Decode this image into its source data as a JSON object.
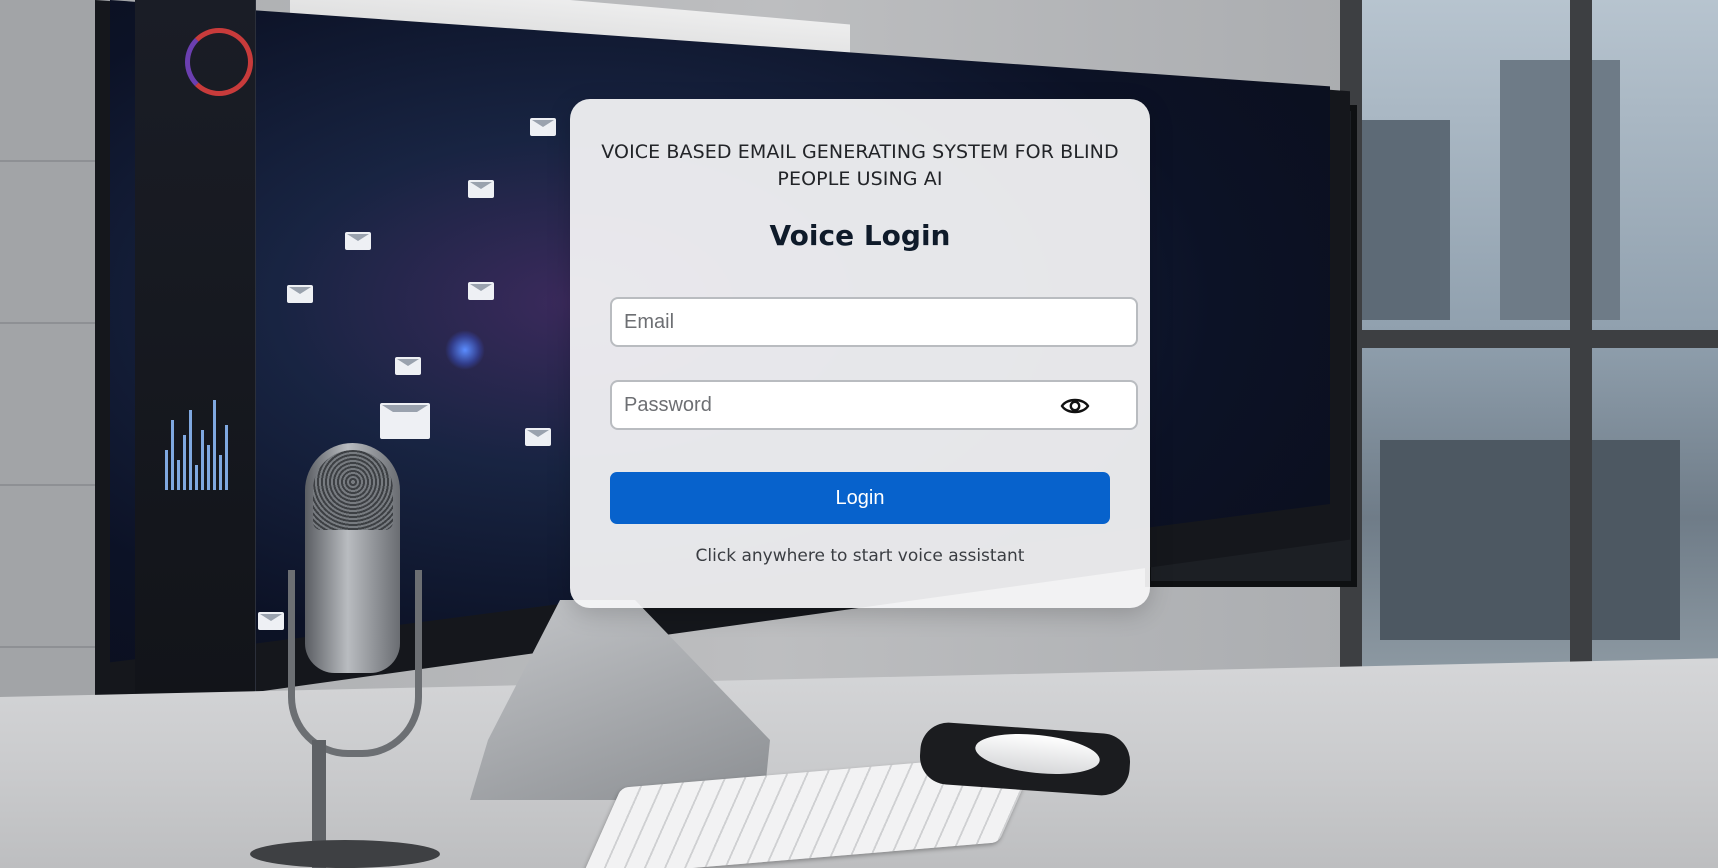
{
  "app": {
    "title": "VOICE BASED EMAIL GENERATING SYSTEM FOR BLIND PEOPLE USING AI"
  },
  "login": {
    "heading": "Voice Login",
    "email_placeholder": "Email",
    "email_value": "",
    "password_placeholder": "Password",
    "password_value": "",
    "password_toggle_icon": "eye-icon",
    "submit_label": "Login",
    "hint": "Click anywhere to start voice assistant"
  },
  "colors": {
    "primary_button": "#0762cc",
    "card_background": "#f6f6f7",
    "heading_text": "#0f1b2a"
  }
}
